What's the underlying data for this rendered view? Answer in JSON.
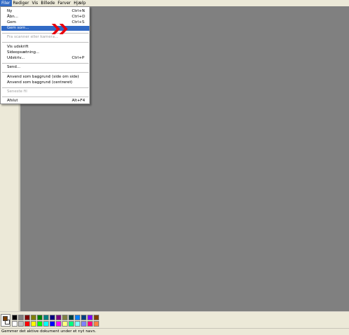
{
  "menubar": {
    "items": [
      {
        "label": "Filer"
      },
      {
        "label": "Rediger"
      },
      {
        "label": "Vis"
      },
      {
        "label": "Billede"
      },
      {
        "label": "Farver"
      },
      {
        "label": "Hjælp"
      }
    ]
  },
  "file_menu": {
    "items": [
      {
        "label": "Ny",
        "shortcut": "Ctrl+N"
      },
      {
        "label": "Åbn...",
        "shortcut": "Ctrl+O"
      },
      {
        "label": "Gem",
        "shortcut": "Ctrl+S"
      },
      {
        "label": "Gem som...",
        "shortcut": ""
      },
      {
        "label": "Fra scanner eller kamera...",
        "shortcut": ""
      },
      {
        "label": "Vis udskrift",
        "shortcut": ""
      },
      {
        "label": "Sideopsætning...",
        "shortcut": ""
      },
      {
        "label": "Udskriv...",
        "shortcut": "Ctrl+P"
      },
      {
        "label": "Send...",
        "shortcut": ""
      },
      {
        "label": "Anvend som baggrund (side om side)",
        "shortcut": ""
      },
      {
        "label": "Anvend som baggrund (centreret)",
        "shortcut": ""
      },
      {
        "label": "Seneste fil",
        "shortcut": ""
      },
      {
        "label": "Afslut",
        "shortcut": "Alt+F4"
      }
    ],
    "highlighted": "Gem som...",
    "disabled": [
      "Fra scanner eller kamera...",
      "Seneste fil"
    ]
  },
  "palette": {
    "foreground": "#7b3f00",
    "background": "#ffffff",
    "top_row": [
      "#000000",
      "#808080",
      "#800000",
      "#808000",
      "#008000",
      "#008080",
      "#000080",
      "#800080",
      "#808040",
      "#004040",
      "#0080ff",
      "#004080",
      "#8000ff",
      "#804000"
    ],
    "bottom_row": [
      "#ffffff",
      "#c0c0c0",
      "#ff0000",
      "#ffff00",
      "#00ff00",
      "#00ffff",
      "#0000ff",
      "#ff00ff",
      "#ffff80",
      "#00ff80",
      "#80ffff",
      "#8080ff",
      "#ff0080",
      "#ff8040"
    ]
  },
  "statusbar": {
    "text": "Gemmer det aktive dokument under et nyt navn."
  },
  "colors": {
    "canvas": "#808080",
    "chrome": "#ece9d8",
    "highlight": "#316ac5",
    "annotation": "#e8000d"
  },
  "annotation": {
    "icon": "double-right-arrow-icon"
  }
}
